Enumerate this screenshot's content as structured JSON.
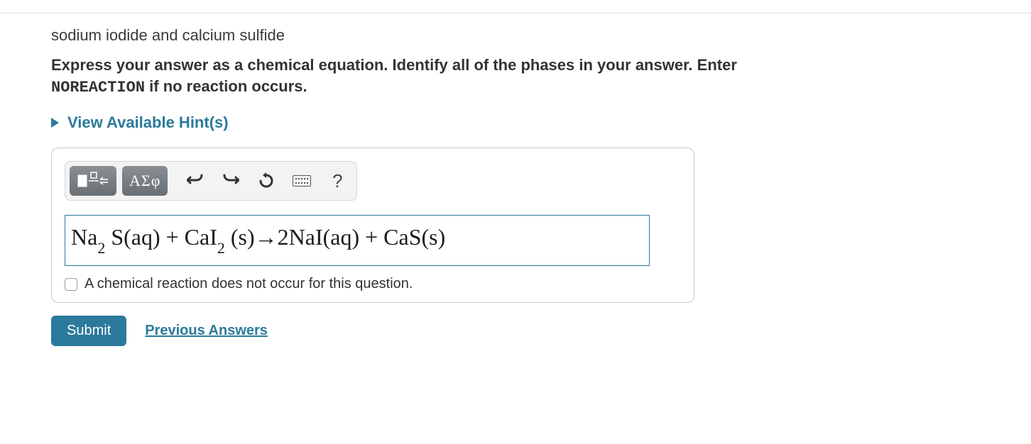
{
  "question": {
    "prompt": "sodium iodide and calcium sulfide",
    "instruction_pre": "Express your answer as a chemical equation. Identify all of the phases in your answer. Enter ",
    "instruction_code": "NOREACTION",
    "instruction_post": " if no reaction occurs."
  },
  "hints": {
    "toggle_label": "View Available Hint(s)"
  },
  "toolbar": {
    "templates_label": "templates",
    "greek_label": "ΑΣφ",
    "undo_label": "undo",
    "redo_label": "redo",
    "reset_label": "reset",
    "keyboard_label": "keyboard",
    "help_label": "?"
  },
  "answer": {
    "equation_html": "Na<sub>2</sub> S(aq) + CaI<sub>2</sub> (s)→2NaI(aq) + CaS(s)",
    "no_reaction_label": "A chemical reaction does not occur for this question.",
    "no_reaction_checked": false
  },
  "actions": {
    "submit": "Submit",
    "previous_answers": "Previous Answers"
  }
}
